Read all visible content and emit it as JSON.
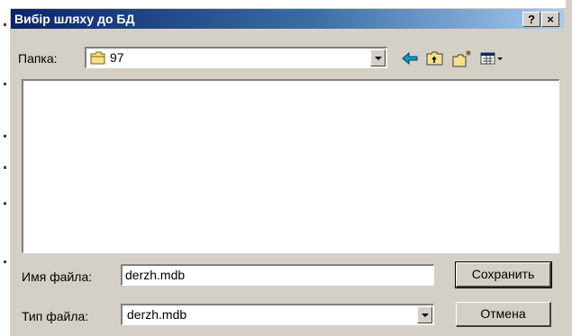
{
  "dialog": {
    "title": "Вибір шляху до БД",
    "help_glyph": "?",
    "close_glyph": "×"
  },
  "lookin": {
    "label": "Папка:",
    "value": "97",
    "toolbar_icons": [
      "back-arrow-icon",
      "up-one-level-icon",
      "new-folder-icon",
      "view-menu-icon"
    ]
  },
  "filename": {
    "label": "Имя файла:",
    "value": "derzh.mdb"
  },
  "filetype": {
    "label": "Тип файла:",
    "value": "derzh.mdb"
  },
  "buttons": {
    "save": "Сохранить",
    "cancel": "Отмена"
  },
  "colors": {
    "titlebar_start": "#0a246a",
    "titlebar_end": "#a6caf0",
    "dialog_face": "#d4d0c8"
  }
}
